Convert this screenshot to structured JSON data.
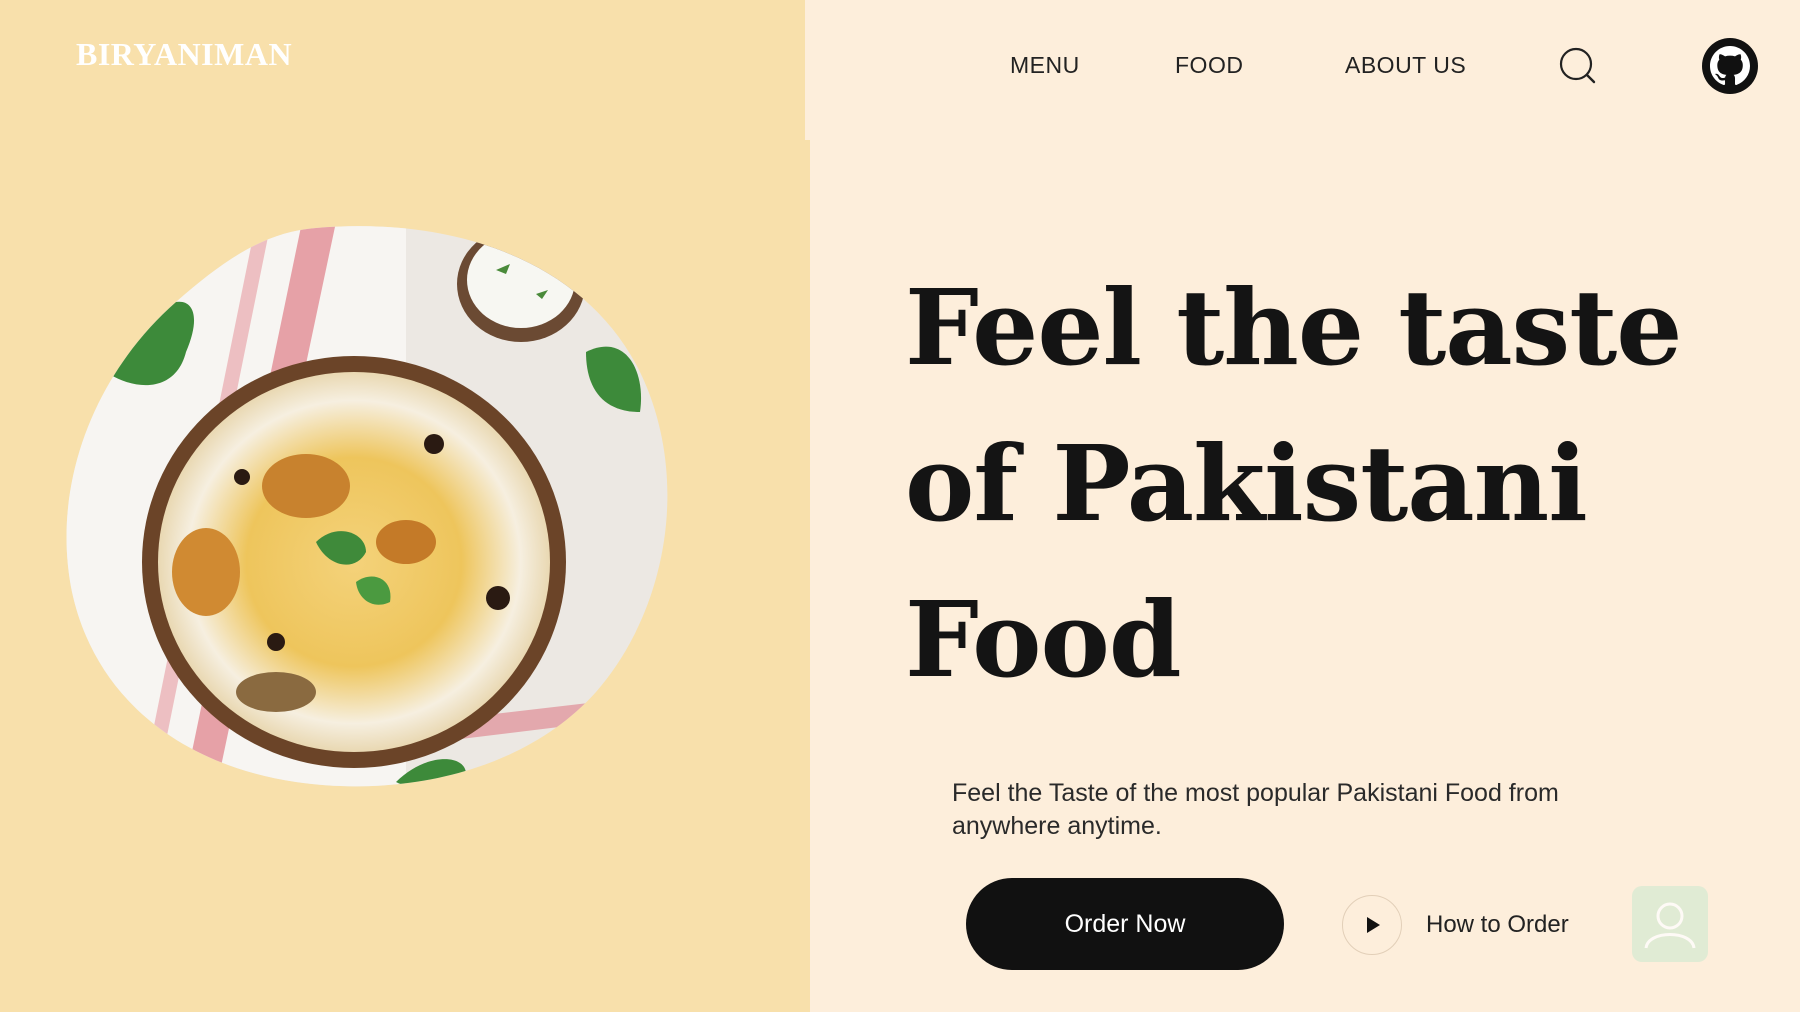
{
  "brand": {
    "logo": "BIRYANIMAN"
  },
  "nav": {
    "items": [
      "MENU",
      "FOOD",
      "ABOUT US"
    ],
    "icons": [
      "search-icon",
      "github-icon"
    ]
  },
  "hero": {
    "title_lines": [
      "Feel the taste",
      "of Pakistani",
      "Food"
    ],
    "subtitle": "Feel the Taste of the most popular Pakistani Food from anywhere anytime.",
    "order_button": "Order Now",
    "how_to_order": "How to Order"
  },
  "colors": {
    "left_panel": "#f8e0ab",
    "right_panel": "#fdeedb",
    "button": "#111111",
    "logo": "#ffffff"
  }
}
